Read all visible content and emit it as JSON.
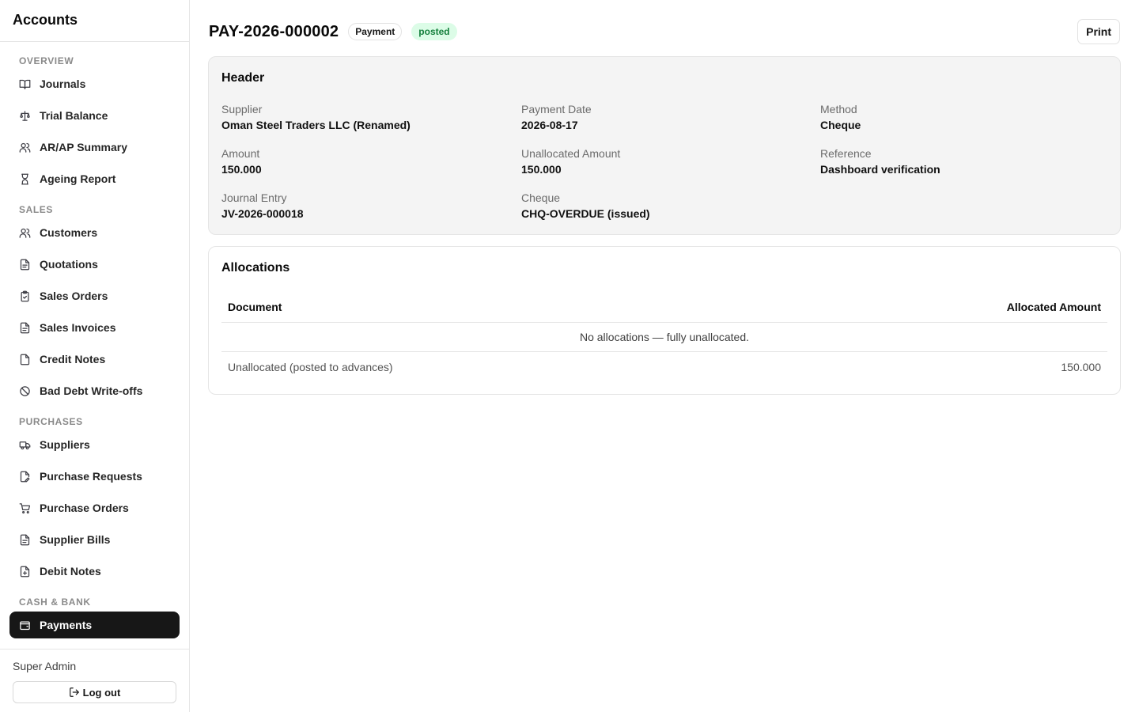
{
  "app": {
    "title": "Accounts"
  },
  "sidebar": {
    "sections": [
      {
        "title": "OVERVIEW",
        "items": [
          {
            "label": "Journals",
            "icon": "book-open-icon"
          },
          {
            "label": "Trial Balance",
            "icon": "scale-icon"
          },
          {
            "label": "AR/AP Summary",
            "icon": "users-icon"
          },
          {
            "label": "Ageing Report",
            "icon": "hourglass-icon"
          }
        ]
      },
      {
        "title": "SALES",
        "items": [
          {
            "label": "Customers",
            "icon": "users-icon"
          },
          {
            "label": "Quotations",
            "icon": "file-text-icon"
          },
          {
            "label": "Sales Orders",
            "icon": "clipboard-check-icon"
          },
          {
            "label": "Sales Invoices",
            "icon": "file-text-icon"
          },
          {
            "label": "Credit Notes",
            "icon": "file-icon"
          },
          {
            "label": "Bad Debt Write-offs",
            "icon": "ban-icon"
          }
        ]
      },
      {
        "title": "PURCHASES",
        "items": [
          {
            "label": "Suppliers",
            "icon": "truck-icon"
          },
          {
            "label": "Purchase Requests",
            "icon": "file-pen-icon"
          },
          {
            "label": "Purchase Orders",
            "icon": "shopping-cart-icon"
          },
          {
            "label": "Supplier Bills",
            "icon": "file-text-icon"
          },
          {
            "label": "Debit Notes",
            "icon": "file-plus-icon"
          }
        ]
      },
      {
        "title": "CASH & BANK",
        "items": [
          {
            "label": "Payments",
            "icon": "wallet-icon",
            "active": true
          }
        ]
      }
    ]
  },
  "footer": {
    "user": "Super Admin",
    "logout_label": "Log out"
  },
  "page": {
    "title": "PAY-2026-000002",
    "type_badge": "Payment",
    "status_badge": "posted",
    "print_label": "Print"
  },
  "header_card": {
    "title": "Header",
    "fields": {
      "supplier": {
        "label": "Supplier",
        "value": "Oman Steel Traders LLC (Renamed)"
      },
      "payment_date": {
        "label": "Payment Date",
        "value": "2026-08-17"
      },
      "method": {
        "label": "Method",
        "value": "Cheque"
      },
      "amount": {
        "label": "Amount",
        "value": "150.000"
      },
      "unallocated_amount": {
        "label": "Unallocated Amount",
        "value": "150.000"
      },
      "reference": {
        "label": "Reference",
        "value": "Dashboard verification"
      },
      "journal_entry": {
        "label": "Journal Entry",
        "value": "JV-2026-000018"
      },
      "cheque": {
        "label": "Cheque",
        "value": "CHQ-OVERDUE (issued)"
      }
    }
  },
  "allocations": {
    "title": "Allocations",
    "columns": [
      "Document",
      "Allocated Amount"
    ],
    "empty_text": "No allocations — fully unallocated.",
    "footer_label": "Unallocated (posted to advances)",
    "footer_value": "150.000"
  }
}
